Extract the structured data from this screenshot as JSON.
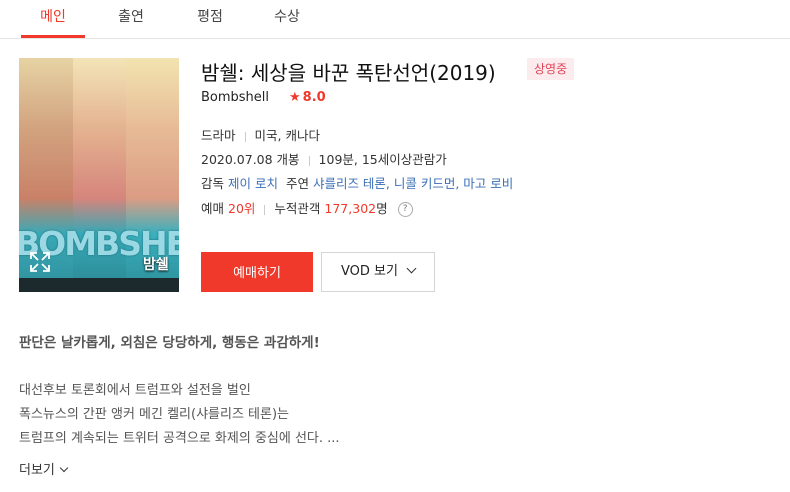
{
  "tabs": [
    {
      "label": "메인",
      "active": true
    },
    {
      "label": "출연",
      "active": false
    },
    {
      "label": "평점",
      "active": false
    },
    {
      "label": "수상",
      "active": false
    }
  ],
  "poster": {
    "title_art": "BOMBSHELL",
    "korean_title": "밤쉘"
  },
  "movie": {
    "title": "밤쉘: 세상을 바꾼 폭탄선언(2019)",
    "status": "상영중",
    "original_title": "Bombshell",
    "rating": "8.0",
    "genre": "드라마",
    "country": "미국, 캐나다",
    "release": "2020.07.08 개봉",
    "runtime_rating": "109분, 15세이상관람가",
    "director_label": "감독",
    "director": "제이 로치",
    "cast_label": "주연",
    "cast": "샤를리즈 테론, 니콜 키드먼, 마고 로비",
    "booking_label": "예매",
    "booking_rank": "20위",
    "audience_label": "누적관객",
    "audience_count": "177,302",
    "audience_unit": "명"
  },
  "buttons": {
    "book": "예매하기",
    "vod": "VOD 보기"
  },
  "synopsis": {
    "tagline": "판단은 날카롭게, 외침은 당당하게, 행동은 과감하게!",
    "lines": [
      "대선후보 토론회에서 트럼프와 설전을 벌인",
      "폭스뉴스의 간판 앵커 메긴 켈리(샤를리즈 테론)는",
      "트럼프의 계속되는 트위터 공격으로 화제의 중심에 선다. ..."
    ],
    "more": "더보기"
  },
  "colors": {
    "accent": "#f0392a",
    "link": "#3b6fb6",
    "badge_bg": "#fdecee",
    "badge_text": "#e34458"
  }
}
